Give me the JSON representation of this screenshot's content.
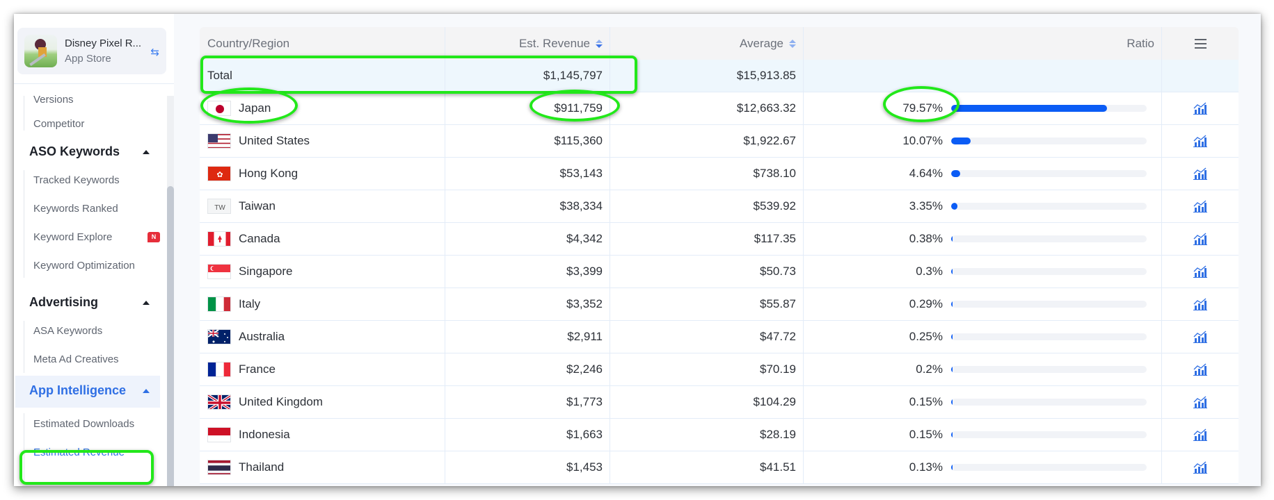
{
  "sidebar": {
    "app": {
      "name": "Disney Pixel R...",
      "store": "App Store",
      "swap_icon": "swap-arrows-icon"
    },
    "items_top": [
      "Versions",
      "Competitor"
    ],
    "groups": [
      {
        "label": "ASO Keywords",
        "items": [
          "Tracked Keywords",
          "Keywords Ranked",
          "Keyword Explore",
          "Keyword Optimization"
        ],
        "badge_item": "Keyword Explore",
        "badge": "N"
      },
      {
        "label": "Advertising",
        "items": [
          "ASA Keywords",
          "Meta Ad Creatives"
        ]
      },
      {
        "label": "App Intelligence",
        "items": [
          "Estimated Downloads",
          "Estimated Revenue"
        ],
        "active": true,
        "active_item": "Estimated Revenue"
      }
    ]
  },
  "table": {
    "headers": {
      "country": "Country/Region",
      "revenue": "Est. Revenue",
      "average": "Average",
      "ratio": "Ratio",
      "menu_icon": "hamburger-menu-icon"
    },
    "total": {
      "label": "Total",
      "revenue": "$1,145,797",
      "average": "$15,913.85"
    },
    "rows": [
      {
        "country": "Japan",
        "flag": "jp",
        "revenue": "$911,759",
        "average": "$12,663.32",
        "ratio": "79.57%",
        "ratio_value": 79.57
      },
      {
        "country": "United States",
        "flag": "us",
        "revenue": "$115,360",
        "average": "$1,922.67",
        "ratio": "10.07%",
        "ratio_value": 10.07
      },
      {
        "country": "Hong Kong",
        "flag": "hk",
        "revenue": "$53,143",
        "average": "$738.10",
        "ratio": "4.64%",
        "ratio_value": 4.64
      },
      {
        "country": "Taiwan",
        "flag": "tw",
        "flag_text": "TW",
        "revenue": "$38,334",
        "average": "$539.92",
        "ratio": "3.35%",
        "ratio_value": 3.35
      },
      {
        "country": "Canada",
        "flag": "ca",
        "revenue": "$4,342",
        "average": "$117.35",
        "ratio": "0.38%",
        "ratio_value": 0.38
      },
      {
        "country": "Singapore",
        "flag": "sg",
        "revenue": "$3,399",
        "average": "$50.73",
        "ratio": "0.3%",
        "ratio_value": 0.3
      },
      {
        "country": "Italy",
        "flag": "it",
        "revenue": "$3,352",
        "average": "$55.87",
        "ratio": "0.29%",
        "ratio_value": 0.29
      },
      {
        "country": "Australia",
        "flag": "au",
        "revenue": "$2,911",
        "average": "$47.72",
        "ratio": "0.25%",
        "ratio_value": 0.25
      },
      {
        "country": "France",
        "flag": "fr",
        "revenue": "$2,246",
        "average": "$70.19",
        "ratio": "0.2%",
        "ratio_value": 0.2
      },
      {
        "country": "United Kingdom",
        "flag": "gb",
        "revenue": "$1,773",
        "average": "$104.29",
        "ratio": "0.15%",
        "ratio_value": 0.15
      },
      {
        "country": "Indonesia",
        "flag": "id",
        "revenue": "$1,663",
        "average": "$28.19",
        "ratio": "0.15%",
        "ratio_value": 0.15
      },
      {
        "country": "Thailand",
        "flag": "th",
        "revenue": "$1,453",
        "average": "$41.51",
        "ratio": "0.13%",
        "ratio_value": 0.13
      }
    ],
    "row_action_icon": "trend-chart-icon"
  },
  "colors": {
    "accent": "#2f6fe4",
    "bar": "#0b5cf5",
    "annotation": "#22e81a",
    "total_row_bg": "#eef7fd"
  },
  "scroll_top_icon": "arrow-up-to-top-icon"
}
